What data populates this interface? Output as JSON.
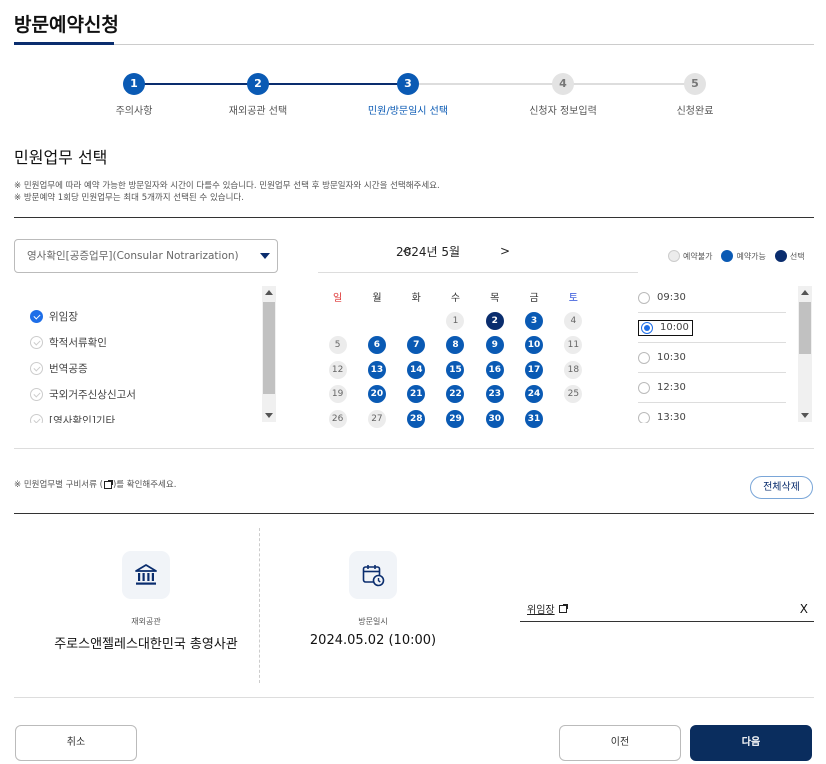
{
  "page": {
    "title": "방문예약신청"
  },
  "steps": [
    {
      "num": "1",
      "label": "주의사항",
      "state": "done"
    },
    {
      "num": "2",
      "label": "재외공관 선택",
      "state": "done"
    },
    {
      "num": "3",
      "label": "민원/방문일시 선택",
      "state": "current"
    },
    {
      "num": "4",
      "label": "신청자 정보입력",
      "state": "todo"
    },
    {
      "num": "5",
      "label": "신청완료",
      "state": "todo"
    }
  ],
  "section": {
    "title": "민원업무 선택",
    "notes": [
      "※ 민원업무에 따라 예약 가능한 방문일자와 시간이 다를수 있습니다. 민원업무 선택 후 방문일자와 시간을 선택해주세요.",
      "※ 방문예약 1회당 민원업무는 최대 5개까지 선택된 수 있습니다."
    ]
  },
  "category_select": {
    "value": "영사확인[공증업무](Consular Notrarization)"
  },
  "tasks": [
    {
      "label": "위임장",
      "checked": true
    },
    {
      "label": "학적서류확인",
      "checked": false
    },
    {
      "label": "번역공증",
      "checked": false
    },
    {
      "label": "국외거주신상신고서",
      "checked": false
    },
    {
      "label": "[영사확인]기타",
      "checked": false
    }
  ],
  "calendar": {
    "month_label": "2024년 5월",
    "prev": "<",
    "next": ">",
    "weekdays": [
      "일",
      "월",
      "화",
      "수",
      "목",
      "금",
      "토"
    ],
    "weeks": [
      [
        null,
        null,
        null,
        {
          "d": "1",
          "s": "unavail"
        },
        {
          "d": "2",
          "s": "selected"
        },
        {
          "d": "3",
          "s": "avail"
        },
        {
          "d": "4",
          "s": "unavail"
        }
      ],
      [
        {
          "d": "5",
          "s": "unavail"
        },
        {
          "d": "6",
          "s": "avail"
        },
        {
          "d": "7",
          "s": "avail"
        },
        {
          "d": "8",
          "s": "avail"
        },
        {
          "d": "9",
          "s": "avail"
        },
        {
          "d": "10",
          "s": "avail"
        },
        {
          "d": "11",
          "s": "unavail"
        }
      ],
      [
        {
          "d": "12",
          "s": "unavail"
        },
        {
          "d": "13",
          "s": "avail"
        },
        {
          "d": "14",
          "s": "avail"
        },
        {
          "d": "15",
          "s": "avail"
        },
        {
          "d": "16",
          "s": "avail"
        },
        {
          "d": "17",
          "s": "avail"
        },
        {
          "d": "18",
          "s": "unavail"
        }
      ],
      [
        {
          "d": "19",
          "s": "unavail"
        },
        {
          "d": "20",
          "s": "avail"
        },
        {
          "d": "21",
          "s": "avail"
        },
        {
          "d": "22",
          "s": "avail"
        },
        {
          "d": "23",
          "s": "avail"
        },
        {
          "d": "24",
          "s": "avail"
        },
        {
          "d": "25",
          "s": "unavail"
        }
      ],
      [
        {
          "d": "26",
          "s": "unavail"
        },
        {
          "d": "27",
          "s": "unavail"
        },
        {
          "d": "28",
          "s": "avail"
        },
        {
          "d": "29",
          "s": "avail"
        },
        {
          "d": "30",
          "s": "avail"
        },
        {
          "d": "31",
          "s": "avail"
        },
        null
      ]
    ]
  },
  "legend": [
    {
      "label": "예약불가",
      "color": "#ececec"
    },
    {
      "label": "예약가능",
      "color": "#0a5ab4"
    },
    {
      "label": "선택",
      "color": "#0a2d6e"
    }
  ],
  "times": [
    {
      "label": "09:30",
      "selected": false
    },
    {
      "label": "10:00",
      "selected": true
    },
    {
      "label": "10:30",
      "selected": false
    },
    {
      "label": "12:30",
      "selected": false
    },
    {
      "label": "13:30",
      "selected": false
    }
  ],
  "doc_note": {
    "before": "※ 민원업무별 구비서류 (",
    "after": ")를 확인해주세요."
  },
  "clear_all_label": "전체삭제",
  "summary": {
    "mission_label": "재외공관",
    "mission_value": "주로스앤젤레스대한민국 총영사관",
    "visit_label": "방문일시",
    "visit_value": "2024.05.02 (10:00)"
  },
  "picked_task": {
    "name": "위임장",
    "remove": "X"
  },
  "buttons": {
    "cancel": "취소",
    "prev": "이전",
    "next": "다음"
  },
  "colors": {
    "brand_dark": "#0a2d6e",
    "available": "#0a5ab4",
    "check": "#1e6ee8"
  }
}
